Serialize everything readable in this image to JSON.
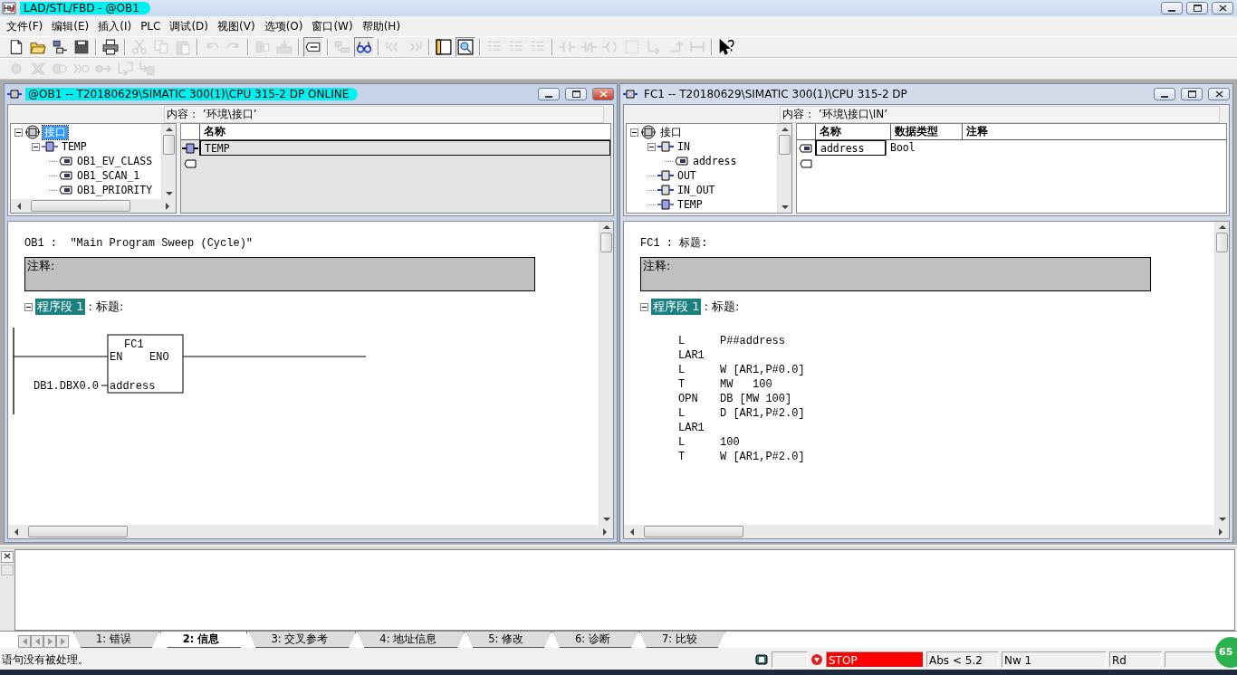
{
  "window": {
    "title": "LAD/STL/FBD  - @OB1",
    "highlighted": true
  },
  "menu": [
    "文件(F)",
    "编辑(E)",
    "插入(I)",
    "PLC",
    "调试(D)",
    "视图(V)",
    "选项(O)",
    "窗口(W)",
    "帮助(H)"
  ],
  "toolbars": [
    [
      {
        "kind": "document",
        "disabled": false,
        "pressed": false
      },
      {
        "kind": "folder",
        "disabled": false,
        "pressed": false
      },
      {
        "kind": "nodes",
        "disabled": false,
        "pressed": false
      },
      {
        "kind": "disk",
        "disabled": false,
        "pressed": false
      },
      {
        "kind": "separator"
      },
      {
        "kind": "printer",
        "disabled": false,
        "pressed": false
      },
      {
        "kind": "separator"
      },
      {
        "kind": "scissors",
        "disabled": true,
        "pressed": false
      },
      {
        "kind": "copy",
        "disabled": true,
        "pressed": false
      },
      {
        "kind": "paste",
        "disabled": true,
        "pressed": false
      },
      {
        "kind": "separator"
      },
      {
        "kind": "undo",
        "disabled": true,
        "pressed": false
      },
      {
        "kind": "redo",
        "disabled": true,
        "pressed": false
      },
      {
        "kind": "separator"
      },
      {
        "kind": "chip",
        "disabled": true,
        "pressed": false
      },
      {
        "kind": "download",
        "disabled": true,
        "pressed": false
      },
      {
        "kind": "separator"
      },
      {
        "kind": "tag",
        "disabled": false,
        "pressed": true
      },
      {
        "kind": "separator"
      },
      {
        "kind": "blocks",
        "disabled": true,
        "pressed": false
      },
      {
        "kind": "glasses",
        "disabled": false,
        "pressed": true
      },
      {
        "kind": "separator"
      },
      {
        "kind": "bar-left",
        "disabled": true,
        "pressed": false
      },
      {
        "kind": "bar-right",
        "disabled": true,
        "pressed": false
      },
      {
        "kind": "separator"
      },
      {
        "kind": "panel",
        "disabled": false,
        "pressed": false
      },
      {
        "kind": "zoom",
        "disabled": false,
        "pressed": true
      },
      {
        "kind": "separator"
      },
      {
        "kind": "list",
        "disabled": true,
        "pressed": false
      },
      {
        "kind": "list",
        "disabled": true,
        "pressed": false
      },
      {
        "kind": "list",
        "disabled": true,
        "pressed": false
      },
      {
        "kind": "separator"
      },
      {
        "kind": "contact",
        "disabled": true,
        "pressed": false
      },
      {
        "kind": "contact-nc",
        "disabled": true,
        "pressed": false
      },
      {
        "kind": "coil",
        "disabled": true,
        "pressed": false
      },
      {
        "kind": "empty-box",
        "disabled": true,
        "pressed": false
      },
      {
        "kind": "branch-open",
        "disabled": true,
        "pressed": false
      },
      {
        "kind": "branch-close",
        "disabled": true,
        "pressed": false
      },
      {
        "kind": "connection",
        "disabled": true,
        "pressed": false
      },
      {
        "kind": "separator"
      },
      {
        "kind": "help",
        "disabled": false,
        "pressed": false
      }
    ],
    [
      {
        "kind": "dot",
        "disabled": true,
        "pressed": false
      },
      {
        "kind": "cross",
        "disabled": true,
        "pressed": false
      },
      {
        "kind": "double-dot",
        "disabled": true,
        "pressed": false
      },
      {
        "kind": "chevron-dot",
        "disabled": true,
        "pressed": false
      },
      {
        "kind": "dot-arrow",
        "disabled": true,
        "pressed": false
      },
      {
        "kind": "arrow-box",
        "disabled": true,
        "pressed": false
      },
      {
        "kind": "arrow-rect",
        "disabled": true,
        "pressed": false
      }
    ]
  ],
  "windows": [
    {
      "title": "@OB1 -- T20180629\\SIMATIC 300(1)\\CPU 315-2 DP  ONLINE",
      "highlighted": true,
      "active": true,
      "online": true,
      "content_path": "内容：  ’环境\\接口’",
      "tree": [
        {
          "label": "接口",
          "kind": "interface",
          "expanded": true,
          "selected": true,
          "children": [
            {
              "label": "TEMP",
              "kind": "temp",
              "expanded": true,
              "selected": false,
              "children": [
                {
                  "label": "OB1_EV_CLASS",
                  "kind": "variable",
                  "selected": false
                },
                {
                  "label": "OB1_SCAN_1",
                  "kind": "variable",
                  "selected": false
                },
                {
                  "label": "OB1_PRIORITY",
                  "kind": "variable",
                  "selected": false
                }
              ]
            }
          ]
        }
      ],
      "table": {
        "columns": [
          "名称"
        ],
        "rows": [
          {
            "kind": "temp",
            "cells": [
              "TEMP"
            ],
            "selected": true
          }
        ]
      },
      "code": {
        "header": "OB1 :  ″Main Program Sweep (Cycle)″",
        "comment": "注释:",
        "network": {
          "label": "程序段 1",
          "title": ": 标题:",
          "expanded": true,
          "selected": true
        },
        "body": {
          "kind": "ladder",
          "block": "FC1",
          "enable_in": "EN",
          "enable_out": "ENO",
          "parameter": "address",
          "operand": "DB1.DBX0.0"
        }
      }
    },
    {
      "title": "FC1 -- T20180629\\SIMATIC 300(1)\\CPU 315-2 DP",
      "highlighted": false,
      "active": false,
      "online": false,
      "content_path": "内容：  ’环境\\接口\\IN’",
      "tree": [
        {
          "label": "接口",
          "kind": "interface",
          "expanded": true,
          "selected": false,
          "children": [
            {
              "label": "IN",
              "kind": "in",
              "expanded": true,
              "selected": false,
              "children": [
                {
                  "label": "address",
                  "kind": "variable",
                  "selected": false
                }
              ]
            },
            {
              "label": "OUT",
              "kind": "out",
              "selected": false
            },
            {
              "label": "IN_OUT",
              "kind": "in",
              "selected": false
            },
            {
              "label": "TEMP",
              "kind": "temp",
              "selected": false
            }
          ]
        }
      ],
      "table": {
        "columns": [
          "名称",
          "数据类型",
          "注释"
        ],
        "rows": [
          {
            "kind": "variable",
            "cells": [
              "address",
              "Bool"
            ],
            "selected": true
          }
        ]
      },
      "code": {
        "header": "FC1 : 标题:",
        "comment": "注释:",
        "network": {
          "label": "程序段 1",
          "title": ": 标题:",
          "expanded": true,
          "selected": true
        },
        "body": {
          "kind": "stl",
          "lines": [
            {
              "op": "L",
              "operand": "P##address"
            },
            {
              "op": "LAR1"
            },
            {
              "op": "L",
              "operand": "W [AR1,P#0.0]"
            },
            {
              "op": "T",
              "operand": "MW   100"
            },
            {
              "op": "OPN",
              "operand": "DB [MW 100]"
            },
            {
              "op": "L",
              "operand": "D [AR1,P#2.0]"
            },
            {
              "op": "LAR1"
            },
            {
              "op": "L",
              "operand": "100"
            },
            {
              "op": "T",
              "operand": "W [AR1,P#2.0]"
            }
          ]
        }
      }
    }
  ],
  "output": {
    "tabs": [
      {
        "label": "1: 错误",
        "selected": false
      },
      {
        "label": "2: 信息",
        "selected": true
      },
      {
        "label": "3: 交叉参考",
        "selected": false
      },
      {
        "label": "4: 地址信息",
        "selected": false
      },
      {
        "label": "5: 修改",
        "selected": false
      },
      {
        "label": "6: 诊断",
        "selected": false
      },
      {
        "label": "7: 比较",
        "selected": false
      }
    ]
  },
  "status_bar": {
    "message": "语句没有被处理。",
    "mode": "STOP",
    "position": "Abs < 5.2",
    "network": "Nw 1",
    "access": "Rd"
  },
  "badge": "65"
}
